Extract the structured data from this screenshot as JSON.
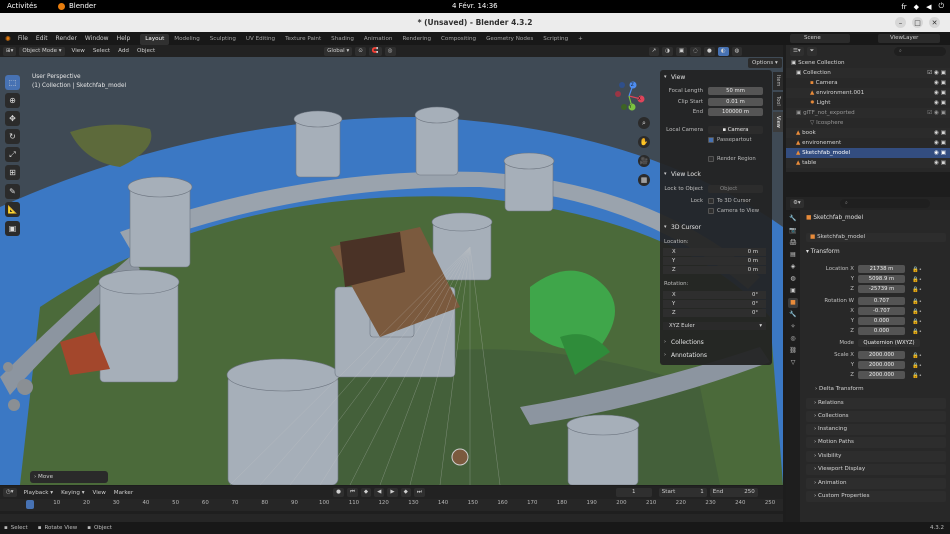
{
  "os_bar": {
    "activities": "Activités",
    "app_name": "Blender",
    "clock": "4 Févr.  14:36",
    "keyboard_layout": "fr"
  },
  "window": {
    "title": "* (Unsaved) - Blender 4.3.2"
  },
  "menubar": {
    "menus": [
      "File",
      "Edit",
      "Render",
      "Window",
      "Help"
    ],
    "workspaces": [
      "Layout",
      "Modeling",
      "Sculpting",
      "UV Editing",
      "Texture Paint",
      "Shading",
      "Animation",
      "Rendering",
      "Compositing",
      "Geometry Nodes",
      "Scripting"
    ],
    "active_workspace": "Layout",
    "add_tab": "+",
    "scene": "Scene",
    "view_layer": "ViewLayer"
  },
  "viewport_header": {
    "mode": "Object Mode",
    "menus": [
      "View",
      "Select",
      "Add",
      "Object"
    ],
    "orientation": "Global",
    "options": "Options"
  },
  "viewport": {
    "view_name": "User Perspective",
    "collection_info": "(1) Collection | Sketchfab_model",
    "last_op": "Move",
    "gizmo_axes": [
      "X",
      "Y",
      "Z"
    ]
  },
  "npanel": {
    "tabs": [
      "Item",
      "Tool",
      "View"
    ],
    "active_tab": "View",
    "view": {
      "title": "View",
      "focal_length_label": "Focal Length",
      "focal_length": "50 mm",
      "clip_start_label": "Clip Start",
      "clip_start": "0.01 m",
      "clip_end_label": "End",
      "clip_end": "100000 m",
      "local_camera_label": "Local Camera",
      "local_camera_value": "Camera",
      "passepartout_label": "Passepartout",
      "render_region_label": "Render Region"
    },
    "view_lock": {
      "title": "View Lock",
      "lock_to_object_label": "Lock to Object",
      "lock_to_object_placeholder": "Object",
      "lock_label": "Lock",
      "to_3d_cursor": "To 3D Cursor",
      "camera_to_view": "Camera to View"
    },
    "cursor": {
      "title": "3D Cursor",
      "location_label": "Location:",
      "location": [
        {
          "axis": "X",
          "value": "0 m"
        },
        {
          "axis": "Y",
          "value": "0 m"
        },
        {
          "axis": "Z",
          "value": "0 m"
        }
      ],
      "rotation_label": "Rotation:",
      "rotation": [
        {
          "axis": "X",
          "value": "0°"
        },
        {
          "axis": "Y",
          "value": "0°"
        },
        {
          "axis": "Z",
          "value": "0°"
        }
      ],
      "rotation_mode": "XYZ Euler"
    },
    "collections": "Collections",
    "annotations": "Annotations"
  },
  "outliner": {
    "search_placeholder": "",
    "rows": [
      {
        "label": "Scene Collection",
        "indent": 0
      },
      {
        "label": "Collection",
        "indent": 1
      },
      {
        "label": "Camera",
        "indent": 2
      },
      {
        "label": "environment.001",
        "indent": 2
      },
      {
        "label": "Light",
        "indent": 2
      },
      {
        "label": "glTF_not_exported",
        "indent": 1
      },
      {
        "label": "Icosphere",
        "indent": 2
      },
      {
        "label": "book",
        "indent": 1
      },
      {
        "label": "environement",
        "indent": 1
      },
      {
        "label": "Sketchfab_model",
        "indent": 1
      },
      {
        "label": "table",
        "indent": 1
      }
    ],
    "selected": "Sketchfab_model"
  },
  "properties": {
    "object_name": "Sketchfab_model",
    "object_datablock": "Sketchfab_model",
    "transform_title": "Transform",
    "location_label": "Location X",
    "location": [
      "21738 m",
      "5098.9 m",
      "-25739 m"
    ],
    "rotation_label": "Rotation W",
    "rotation": [
      "0.707",
      "-0.707",
      "0.000",
      "0.000"
    ],
    "mode_label": "Mode",
    "mode": "Quaternion (WXYZ)",
    "scale_label": "Scale X",
    "scale": [
      "2000.000",
      "2000.000",
      "2000.000"
    ],
    "axis_labels": [
      "X",
      "Y",
      "Z"
    ],
    "delta_transform": "Delta Transform",
    "sections": [
      "Relations",
      "Collections",
      "Instancing",
      "Motion Paths",
      "Visibility",
      "Viewport Display",
      "Animation",
      "Custom Properties"
    ]
  },
  "timeline": {
    "menus": [
      "Playback",
      "Keying",
      "View",
      "Marker"
    ],
    "current_frame": "1",
    "start_label": "Start",
    "start": "1",
    "end_label": "End",
    "end": "250",
    "ticks": [
      "1",
      "10",
      "20",
      "30",
      "40",
      "50",
      "60",
      "70",
      "80",
      "90",
      "100",
      "110",
      "120",
      "130",
      "140",
      "150",
      "160",
      "170",
      "180",
      "190",
      "200",
      "210",
      "220",
      "230",
      "240",
      "250"
    ]
  },
  "statusbar": {
    "hints": [
      "Select",
      "Rotate View",
      "Object"
    ],
    "version": "4.3.2"
  },
  "colors": {
    "accent_blue": "#4772b3",
    "selected_row": "#334d80",
    "sky_blue": "#3b78c4",
    "ground_green": "#4b6a3a",
    "stone_gray": "#9aa3ad"
  }
}
